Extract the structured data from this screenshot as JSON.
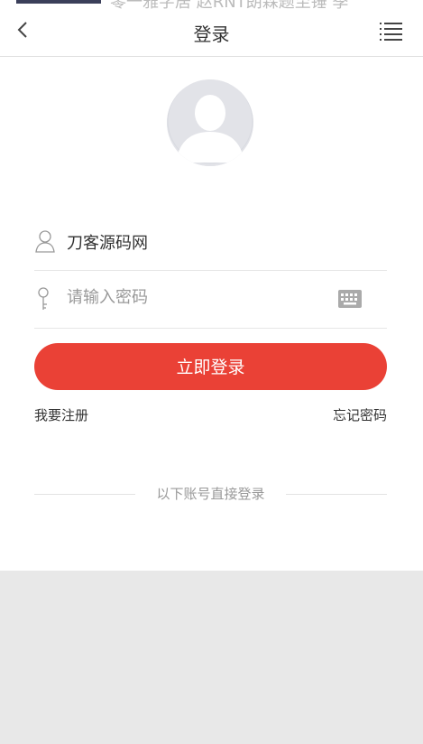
{
  "top_strip": {
    "faint_text": "零一雅字居  赵RNT朗霖题至锤  季"
  },
  "header": {
    "title": "登录"
  },
  "form": {
    "username_value": "刀客源码网",
    "password_placeholder": "请输入密码",
    "login_label": "立即登录"
  },
  "links": {
    "register": "我要注册",
    "forgot": "忘记密码"
  },
  "divider": {
    "text": "以下账号直接登录"
  },
  "colors": {
    "accent": "#ea4136",
    "avatar_bg": "#e2e3e8"
  }
}
